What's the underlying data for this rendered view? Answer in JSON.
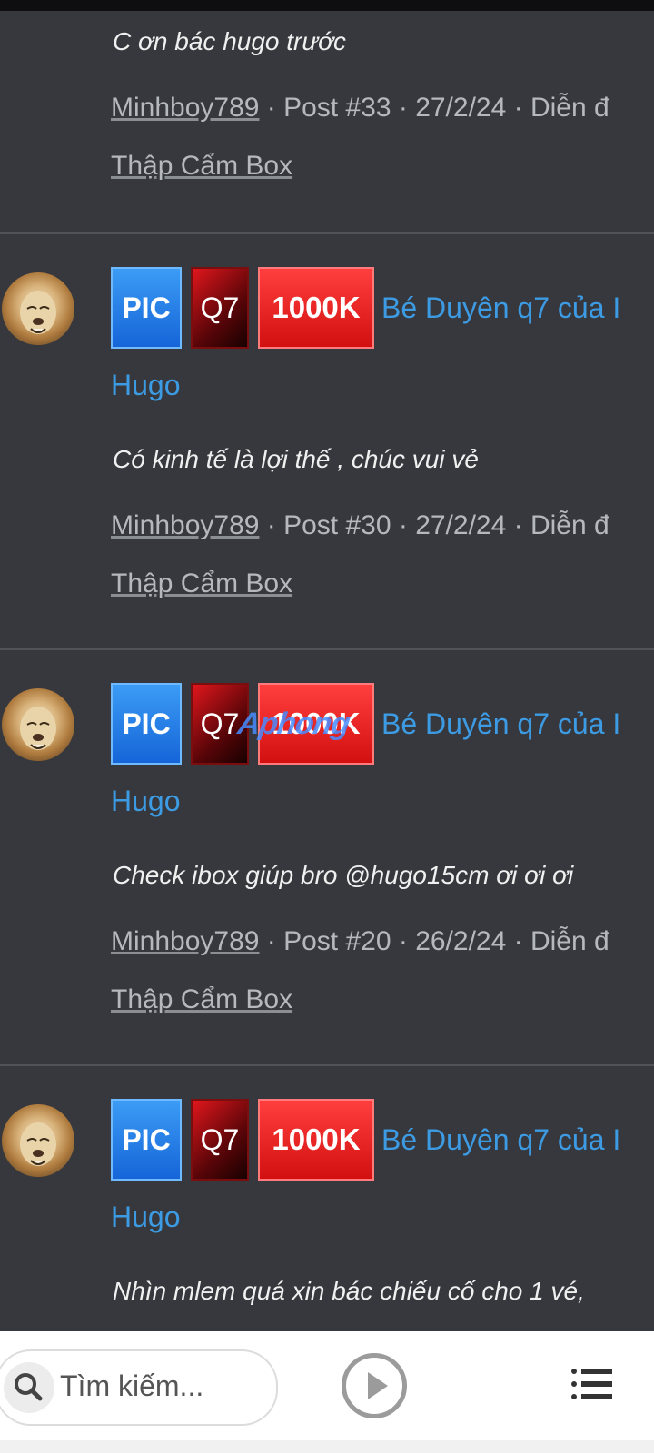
{
  "colors": {
    "background": "#36383d",
    "link": "#3d9be4",
    "meta": "#b5b8bd"
  },
  "prefixes": {
    "pic": "PIC",
    "q7": "Q7",
    "price": "1000K"
  },
  "thread": {
    "title_line1": "Bé Duyên q7 của I",
    "title_line2": "Hugo",
    "forum": "Thập Cẩm Box"
  },
  "posts": [
    {
      "snippet": "C ơn bác hugo trước",
      "user": "Minhboy789",
      "meta_rest": " · Post #33 · 27/2/24 · Diễn đ"
    },
    {
      "snippet": "Có kinh tế là lợi thế , chúc vui vẻ",
      "user": "Minhboy789",
      "meta_rest": " · Post #30 · 27/2/24 · Diễn đ"
    },
    {
      "snippet": "Check ibox giúp bro @hugo15cm ơi ơi ơi",
      "user": "Minhboy789",
      "meta_rest": " · Post #20 · 26/2/24 · Diễn đ"
    },
    {
      "snippet": "Nhìn mlem quá xin bác chiếu cố cho 1 vé,"
    }
  ],
  "watermark": "Aphong",
  "bottom_bar": {
    "search_placeholder": "Tìm kiếm...",
    "icons": [
      "search-icon",
      "play-icon",
      "menu-list-icon"
    ]
  }
}
